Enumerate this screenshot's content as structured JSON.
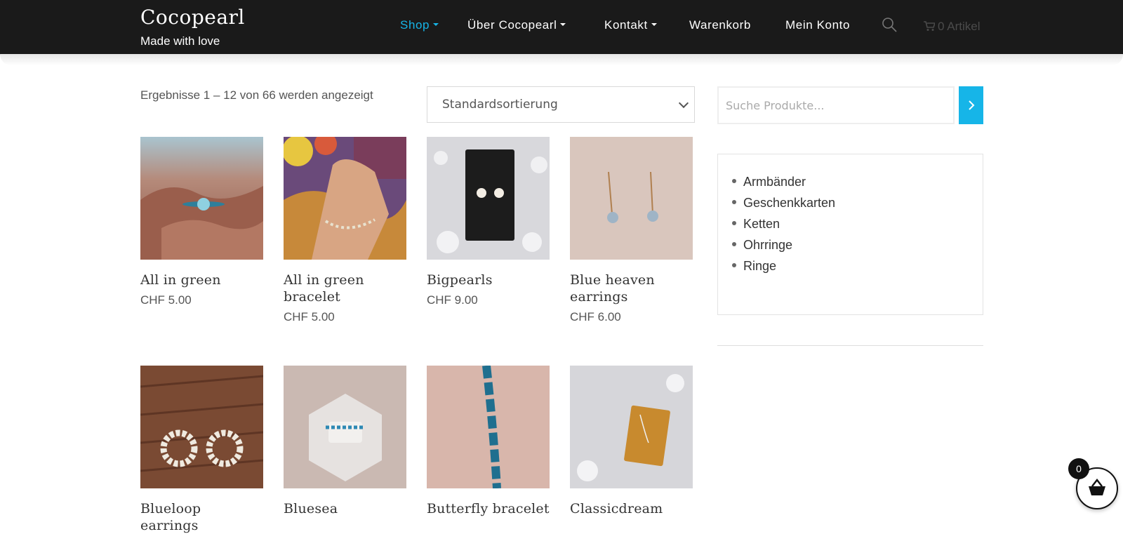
{
  "brand": {
    "title": "Cocopearl",
    "tagline": "Made with love"
  },
  "nav": {
    "items": [
      {
        "label": "Shop",
        "dropdown": true,
        "active": true
      },
      {
        "label": "Über Cocopearl",
        "dropdown": true,
        "active": false
      },
      {
        "label": "Kontakt",
        "dropdown": true,
        "active": false
      },
      {
        "label": "Warenkorb",
        "dropdown": false,
        "active": false
      },
      {
        "label": "Mein Konto",
        "dropdown": false,
        "active": false
      }
    ],
    "cart_label": "0 Artikel"
  },
  "colors": {
    "accent": "#16b5e8",
    "header_bg": "#1a1a1a"
  },
  "toolbar": {
    "result_count": "Ergebnisse 1 – 12 von 66 werden angezeigt",
    "sort_selected": "Standardsortierung"
  },
  "products": [
    {
      "name": "All in green",
      "price": "CHF 5.00"
    },
    {
      "name": "All in green bracelet",
      "price": "CHF 5.00"
    },
    {
      "name": "Bigpearls",
      "price": "CHF 9.00"
    },
    {
      "name": "Blue heaven earrings",
      "price": "CHF 6.00"
    },
    {
      "name": "Blueloop earrings",
      "price": ""
    },
    {
      "name": "Bluesea",
      "price": ""
    },
    {
      "name": "Butterfly bracelet",
      "price": ""
    },
    {
      "name": "Classicdream",
      "price": ""
    }
  ],
  "sidebar": {
    "search_placeholder": "Suche Produkte...",
    "categories": [
      "Armbänder",
      "Geschenkkarten",
      "Ketten",
      "Ohrringe",
      "Ringe"
    ]
  },
  "floating_cart": {
    "count": "0"
  }
}
